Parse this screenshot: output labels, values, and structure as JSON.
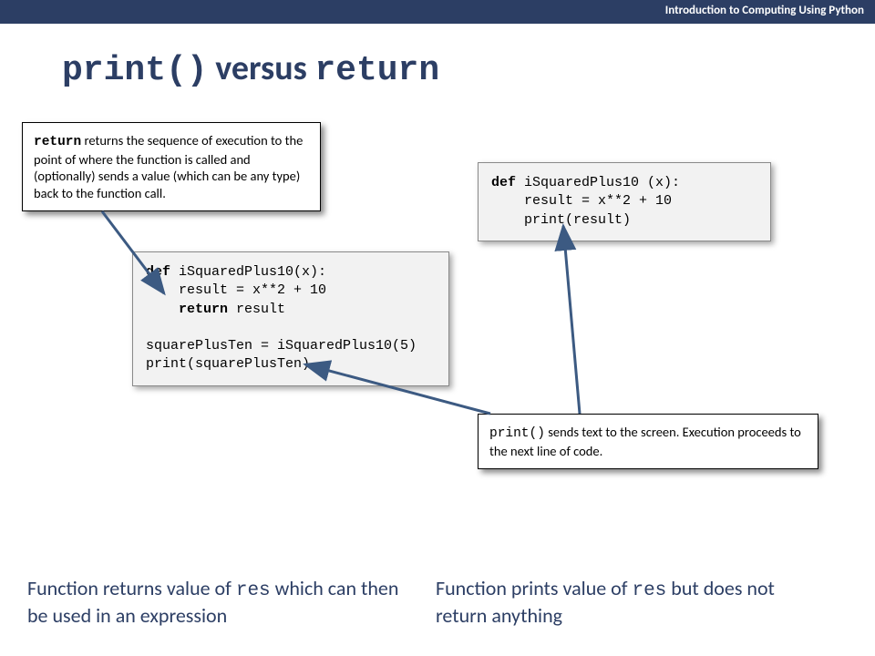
{
  "header": {
    "text": "Introduction to Computing Using Python"
  },
  "title": {
    "part1": "print()",
    "part2": " versus ",
    "part3": "return"
  },
  "callout_return": {
    "kw": "return",
    "text": "  returns the sequence of execution to the point of where the function is called and (optionally) sends a value (which can be any type) back to the function call."
  },
  "callout_print": {
    "kw": "print()",
    "text": "  sends text to the screen. Execution proceeds to the next line of code."
  },
  "code_left": {
    "l1a": "def",
    "l1b": " iSquaredPlus10(x):",
    "l2": "    result = x**2 + 10",
    "l3a": "    ",
    "l3b": "return",
    "l3c": " result",
    "l4": "",
    "l5": "squarePlusTen = iSquaredPlus10(5)",
    "l6": "print(squarePlusTen)"
  },
  "code_right": {
    "l1a": "def",
    "l1b": " iSquaredPlus10 (x):",
    "l2": "    result = x**2 + 10",
    "l3": "    print(result)"
  },
  "caption_left": {
    "t1": "Function returns value of ",
    "code": "res",
    "t2": " which can then be used in an expression"
  },
  "caption_right": {
    "t1": "Function prints value of ",
    "code": "res",
    "t2": " but does not return anything"
  }
}
